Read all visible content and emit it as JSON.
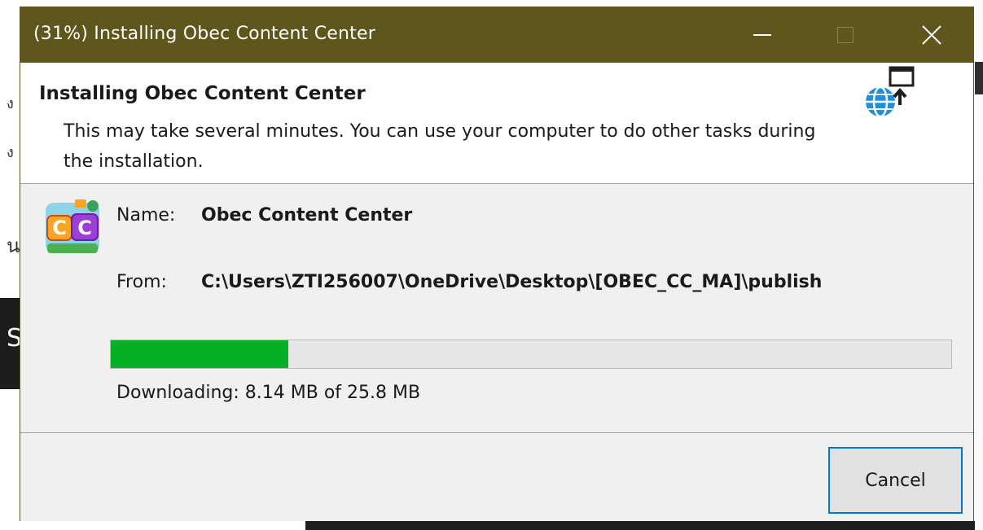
{
  "window": {
    "title": "(31%) Installing Obec Content Center"
  },
  "header": {
    "title": "Installing Obec Content Center",
    "description": "This may take several minutes. You can use your computer to do other tasks during the installation.",
    "icon": "globe-install-icon"
  },
  "details": {
    "name_label": "Name:",
    "name_value": "Obec Content Center",
    "from_label": "From:",
    "from_value": "C:\\Users\\ZTI256007\\OneDrive\\Desktop\\[OBEC_CC_MA]\\publish",
    "app_icon": "obec-cc-app-icon"
  },
  "progress": {
    "percent": 31,
    "color": "#06b025",
    "status": "Downloading: 8.14 MB of 25.8 MB"
  },
  "footer": {
    "cancel_label": "Cancel"
  },
  "colors": {
    "titlebar": "#5f561e",
    "accent": "#0078d7"
  }
}
